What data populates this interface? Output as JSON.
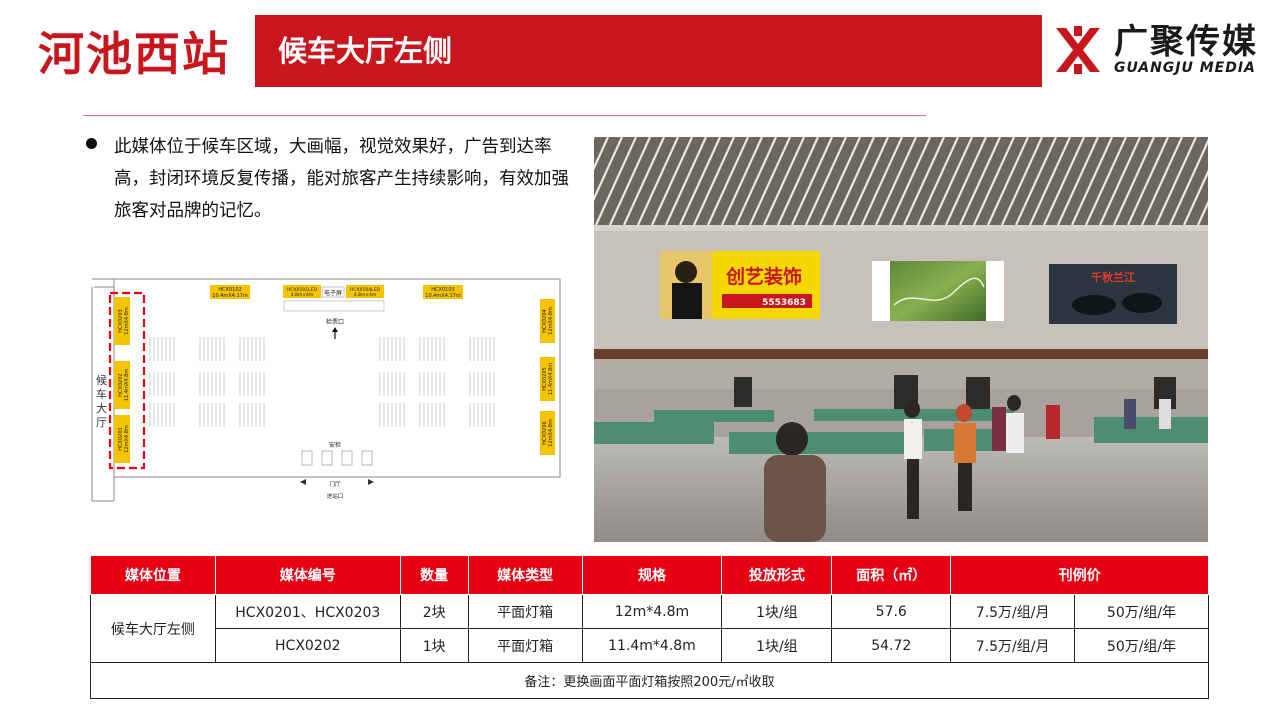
{
  "header": {
    "station": "河池西站",
    "location": "候车大厅左侧",
    "logo_cn": "广聚传媒",
    "logo_en": "GUANGJU MEDIA"
  },
  "description": "此媒体位于候车区域，大画幅，视觉效果好，广告到达率高，封闭环境反复传播，能对旅客产生持续影响，有效加强旅客对品牌的记忆。",
  "colors": {
    "brand_red": "#c8161d",
    "table_header": "#e60012",
    "billboard_yellow": "#f5c400"
  },
  "floor_plan": {
    "hall_label": "候车大厅",
    "labels": {
      "top_left": "HCX0102\n10.4mX4.17m",
      "top_mid_a": "HCX0101LED\n4.8m×4m",
      "top_mid_b": "HCX0104LED\n4.8m×4m",
      "top_mid_screen": "电子屏",
      "top_right": "HCX0103\n10.4mX4.17m",
      "left_top": "HCX0203\n12mX4.8m",
      "left_mid": "HCX0202\n11.4mX4.8m",
      "left_bot": "HCX0201\n12mX4.8m",
      "right_top": "HCX0204\n12mX4.8m",
      "right_mid": "HCX0205\n11.4mX4.8m",
      "right_bot": "HCX0206\n12mX4.8m",
      "gate": "检票口",
      "security": "安检",
      "entrance_hall": "门厅",
      "entrance": "进站口"
    }
  },
  "photo": {
    "billboard_left_brand": "创艺装饰",
    "billboard_left_phone": "5553683",
    "billboard_right_text": "千秋兰江"
  },
  "table": {
    "headers": [
      "媒体位置",
      "媒体编号",
      "数量",
      "媒体类型",
      "规格",
      "投放形式",
      "面积（㎡）",
      "刊例价"
    ],
    "location": "候车大厅左侧",
    "rows": [
      {
        "code": "HCX0201、HCX0203",
        "qty": "2块",
        "type": "平面灯箱",
        "spec": "12m*4.8m",
        "form": "1块/组",
        "area": "57.6",
        "price_month": "7.5万/组/月",
        "price_year": "50万/组/年"
      },
      {
        "code": "HCX0202",
        "qty": "1块",
        "type": "平面灯箱",
        "spec": "11.4m*4.8m",
        "form": "1块/组",
        "area": "54.72",
        "price_month": "7.5万/组/月",
        "price_year": "50万/组/年"
      }
    ],
    "note": "备注：更换画面平面灯箱按照200元/㎡收取"
  }
}
